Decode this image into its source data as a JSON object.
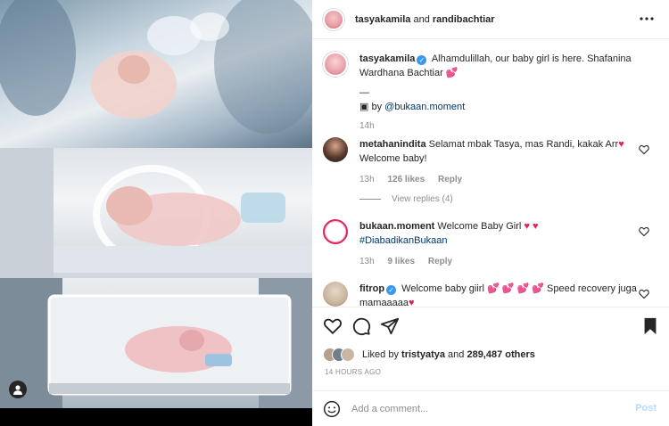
{
  "header": {
    "username": "tasyakamila",
    "connector": "and",
    "collaborator": "randibachtiar",
    "more_icon": "more-horizontal-icon"
  },
  "caption": {
    "username": "tasyakamila",
    "text": "Alhamdulillah, our baby girl is here. Shafanina Wardhana Bachtiar",
    "emoji": "💕",
    "divider": "—",
    "credit_icon": "camera-icon",
    "credit_prefix": "by",
    "credit_handle": "@bukaan.moment",
    "time": "14h"
  },
  "comments": [
    {
      "username": "metahanindita",
      "text": "Selamat mbak Tasya, mas Randi, kakak Arr",
      "emoji": "♥",
      "text2": "Welcome baby!",
      "time": "13h",
      "likes": "126 likes",
      "reply": "Reply",
      "view_replies": "View replies (4)"
    },
    {
      "username": "bukaan.moment",
      "text": "Welcome Baby Girl",
      "emoji": "♥ ♥",
      "hashtag": "#DiabadikanBukaan",
      "time": "13h",
      "likes": "9 likes",
      "reply": "Reply"
    },
    {
      "username": "fitrop",
      "text": "Welcome baby giirl",
      "emoji": "💕 💕 💕 💕",
      "text2": "Speed recovery juga mamaaaaa",
      "emoji2": "♥"
    }
  ],
  "actions": {
    "like_icon": "heart-icon",
    "comment_icon": "comment-icon",
    "share_icon": "send-icon",
    "save_icon": "bookmark-icon"
  },
  "likes": {
    "prefix": "Liked by",
    "user": "tristyatya",
    "middle": "and",
    "count": "289,487 others"
  },
  "timestamp": "14 HOURS AGO",
  "add_comment": {
    "emoji_icon": "smiley-icon",
    "placeholder": "Add a comment...",
    "post_label": "Post"
  },
  "colors": {
    "verified": "#3897f0",
    "heart": "#e0245e",
    "link": "#00376b",
    "post_disabled": "#b3dbff",
    "muted": "#8e8e8e"
  }
}
